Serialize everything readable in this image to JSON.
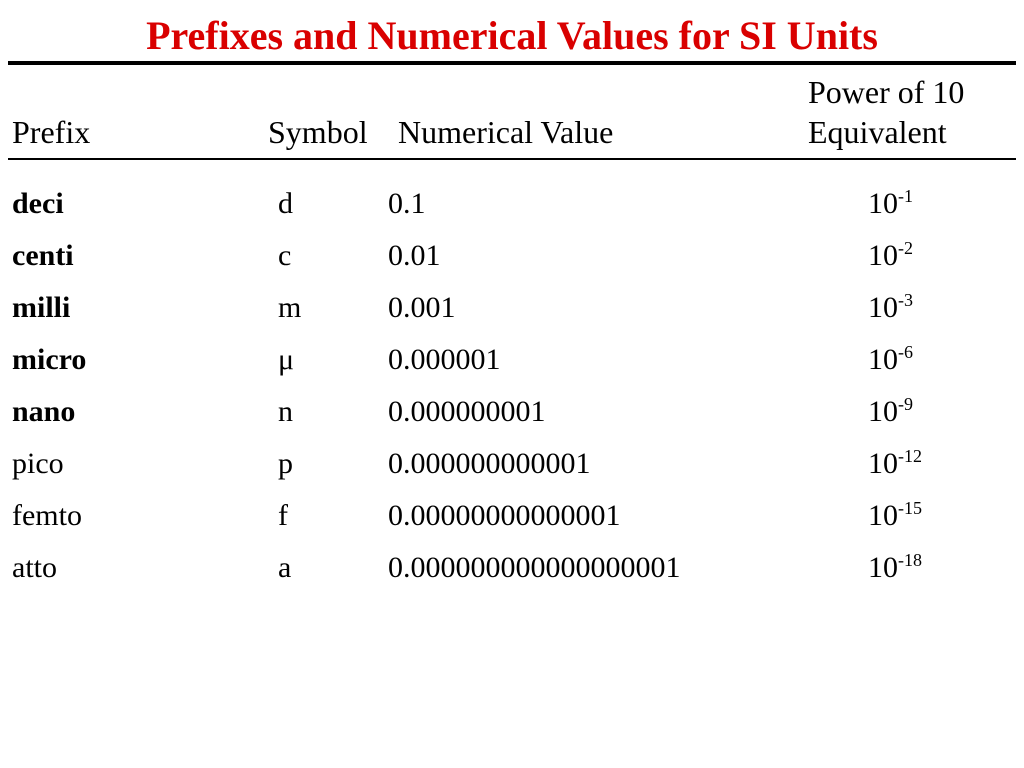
{
  "title": "Prefixes and Numerical Values for SI Units",
  "header": {
    "power_top": "Power of 10",
    "prefix": "Prefix",
    "symbol": "Symbol",
    "numval": "Numerical Value",
    "equivalent": "Equivalent"
  },
  "rows": [
    {
      "prefix": "deci",
      "symbol": "d",
      "numval": "0.1",
      "power_base": "10",
      "power_exp": "-1",
      "bold": true
    },
    {
      "prefix": "centi",
      "symbol": "c",
      "numval": "0.01",
      "power_base": "10",
      "power_exp": "-2",
      "bold": true
    },
    {
      "prefix": "milli",
      "symbol": "m",
      "numval": "0.001",
      "power_base": "10",
      "power_exp": "-3",
      "bold": true
    },
    {
      "prefix": "micro",
      "symbol": "μ",
      "numval": "0.000001",
      "power_base": "10",
      "power_exp": "-6",
      "bold": true
    },
    {
      "prefix": "nano",
      "symbol": "n",
      "numval": "0.000000001",
      "power_base": "10",
      "power_exp": "-9",
      "bold": true
    },
    {
      "prefix": "pico",
      "symbol": "p",
      "numval": "0.000000000001",
      "power_base": "10",
      "power_exp": "-12",
      "bold": false
    },
    {
      "prefix": "femto",
      "symbol": "f",
      "numval": "0.00000000000001",
      "power_base": "10",
      "power_exp": "-15",
      "bold": false
    },
    {
      "prefix": "atto",
      "symbol": "a",
      "numval": "0.000000000000000001",
      "power_base": "10",
      "power_exp": "-18",
      "bold": false
    }
  ],
  "chart_data": {
    "type": "table",
    "title": "Prefixes and Numerical Values for SI Units",
    "columns": [
      "Prefix",
      "Symbol",
      "Numerical Value",
      "Power of 10 Equivalent"
    ],
    "rows": [
      [
        "deci",
        "d",
        0.1,
        "10^-1"
      ],
      [
        "centi",
        "c",
        0.01,
        "10^-2"
      ],
      [
        "milli",
        "m",
        0.001,
        "10^-3"
      ],
      [
        "micro",
        "μ",
        1e-06,
        "10^-6"
      ],
      [
        "nano",
        "n",
        1e-09,
        "10^-9"
      ],
      [
        "pico",
        "p",
        1e-12,
        "10^-12"
      ],
      [
        "femto",
        "f",
        1e-14,
        "10^-15"
      ],
      [
        "atto",
        "a",
        1e-18,
        "10^-18"
      ]
    ]
  }
}
